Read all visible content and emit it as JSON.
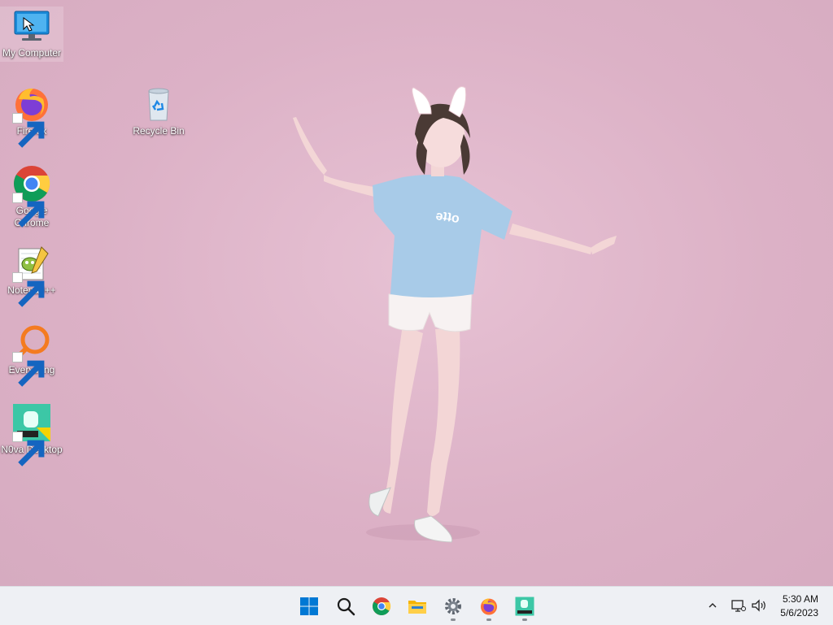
{
  "desktop": {
    "icons": [
      {
        "label": "My Computer",
        "icon": "monitor-icon",
        "shortcut": false
      },
      {
        "label": "Firefox",
        "icon": "firefox-icon",
        "shortcut": true
      },
      {
        "label": "Recycle Bin",
        "icon": "recycle-bin-icon",
        "shortcut": false
      },
      {
        "label": "Google Chrome",
        "icon": "chrome-icon",
        "shortcut": true
      },
      {
        "label": "Notepad++",
        "icon": "notepadpp-icon",
        "shortcut": true
      },
      {
        "label": "Everything",
        "icon": "everything-search-icon",
        "shortcut": true
      },
      {
        "label": "N0va Desktop",
        "icon": "nova-desktop-icon",
        "shortcut": true
      }
    ],
    "wallpaper": {
      "description_icon": "anime-girl-bunny-ears-wallpaper",
      "background_color": "#dfb7cb"
    }
  },
  "taskbar": {
    "apps": [
      {
        "name": "Start",
        "icon": "windows-start-icon",
        "running": false
      },
      {
        "name": "Search",
        "icon": "search-icon",
        "running": false
      },
      {
        "name": "Google Chrome",
        "icon": "chrome-icon",
        "running": false
      },
      {
        "name": "File Explorer",
        "icon": "folder-icon",
        "running": false
      },
      {
        "name": "Settings",
        "icon": "gear-icon",
        "running": true
      },
      {
        "name": "Firefox",
        "icon": "firefox-icon",
        "running": true
      },
      {
        "name": "N0va Desktop",
        "icon": "nova-desktop-icon",
        "running": true
      }
    ],
    "tray": {
      "overflow_icon": "chevron-up-icon",
      "network_icon": "network-icon",
      "volume_icon": "volume-icon"
    },
    "clock": {
      "time": "5:30 AM",
      "date": "5/6/2023"
    },
    "accent_color": "#0078d4"
  }
}
